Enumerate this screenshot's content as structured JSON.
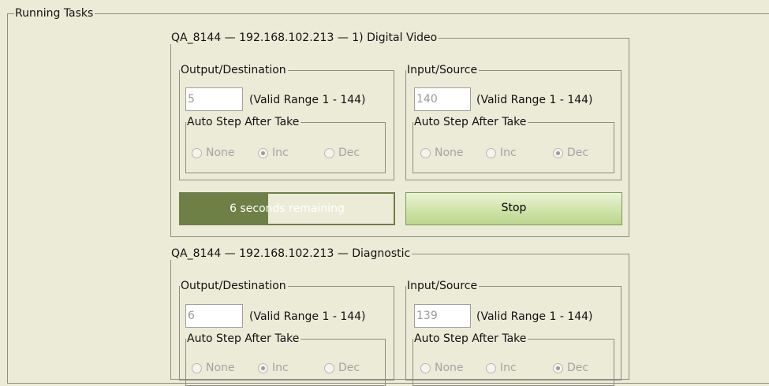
{
  "running_tasks": {
    "title": "Running Tasks"
  },
  "tasks": [
    {
      "title": "QA_8144 — 192.168.102.213 — 1) Digital Video",
      "output": {
        "title": "Output/Destination",
        "value": "5",
        "range": "(Valid Range 1 - 144)",
        "auto_step": {
          "title": "Auto Step After Take",
          "options": [
            "None",
            "Inc",
            "Dec"
          ],
          "selected": "Inc"
        }
      },
      "input": {
        "title": "Input/Source",
        "value": "140",
        "range": "(Valid Range 1 - 144)",
        "auto_step": {
          "title": "Auto Step After Take",
          "options": [
            "None",
            "Inc",
            "Dec"
          ],
          "selected": "Dec"
        }
      },
      "progress": {
        "text": "6 seconds remaining",
        "fraction": 0.41
      },
      "stop_label": "Stop"
    },
    {
      "title": "QA_8144 — 192.168.102.213 — Diagnostic",
      "output": {
        "title": "Output/Destination",
        "value": "6",
        "range": "(Valid Range 1 - 144)",
        "auto_step": {
          "title": "Auto Step After Take",
          "options": [
            "None",
            "Inc",
            "Dec"
          ],
          "selected": "Inc"
        }
      },
      "input": {
        "title": "Input/Source",
        "value": "139",
        "range": "(Valid Range 1 - 144)",
        "auto_step": {
          "title": "Auto Step After Take",
          "options": [
            "None",
            "Inc",
            "Dec"
          ],
          "selected": "Dec"
        }
      }
    }
  ],
  "colors": {
    "background": "#ecebd8",
    "progress_fill": "#6f8047",
    "stop_button": "#cfe3a9"
  }
}
